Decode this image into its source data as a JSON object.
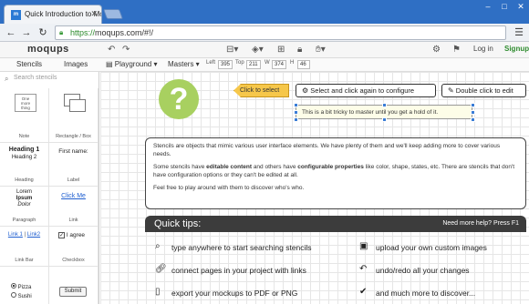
{
  "browser": {
    "tab_title": "Quick Introduction to Mo",
    "favicon_label": "m",
    "url_scheme": "https://",
    "url_rest": "moqups.com/#!/"
  },
  "app": {
    "logo": "moqups",
    "login": "Log in",
    "signup": "Signup"
  },
  "subtoolbar": {
    "stencils_tab": "Stencils",
    "images_tab": "Images",
    "playground": "Playground",
    "masters": "Masters",
    "left_label": "Left",
    "left_value": "395",
    "top_label": "Top",
    "top_value": "211",
    "w_label": "W",
    "w_value": "374",
    "h_label": "H",
    "h_value": "46"
  },
  "stencils": {
    "search_placeholder": "Search stencils",
    "note_text": "One more thing",
    "note_cap": "Note",
    "rect_cap": "Rectangle / Box",
    "heading1": "Heading 1",
    "heading2": "Heading 2",
    "heading_cap": "Heading",
    "label_text": "First name:",
    "label_cap": "Label",
    "para1": "Lorem",
    "para2": "Ipsum",
    "para3": "Dolor",
    "para_cap": "Paragraph",
    "link_text": "Click Me",
    "link_cap": "Link",
    "linkbar_1": "Link 1",
    "linkbar_sep": "|",
    "linkbar_2": "Link2",
    "linkbar_cap": "Link Bar",
    "checkbox_text": "I agree",
    "checkbox_cap": "Checkbox",
    "radio_1": "Pizza",
    "radio_2": "Sushi",
    "submit": "Submit"
  },
  "canvas": {
    "qmark": "?",
    "callout": "Click to select",
    "select_box": "Select and click again to configure",
    "double_box": "Double click to edit",
    "tooltip": "This is a bit tricky to master until you get a hold of it.",
    "info_p1": "Stencils are objects that mimic various user interface elements. We have plenty of them and we'll keep adding more to cover various needs.",
    "info_p2a": "Some stencils have ",
    "info_p2b": "editable content",
    "info_p2c": " and others have ",
    "info_p2d": "configurable properties",
    "info_p2e": " like color, shape, states, etc. There are stencils that don't have configuration options or they can't be edited at all.",
    "info_p3": "Feel free to play around with them to discover who's who.",
    "quick_title": "Quick tips:",
    "quick_help": "Need more help? Press F1",
    "tip1": "type anywhere to start searching stencils",
    "tip2": "upload your own custom images",
    "tip3": "connect pages in your project with links",
    "tip4": "undo/redo all your changes",
    "tip5": "export your mockups to PDF or PNG",
    "tip6": "and much more to discover..."
  },
  "colors": {
    "chrome_blue": "#2f6fc4",
    "accent_green": "#a8d060",
    "callout_yellow": "#f6c74a",
    "signup_green": "#2f8c2f"
  }
}
